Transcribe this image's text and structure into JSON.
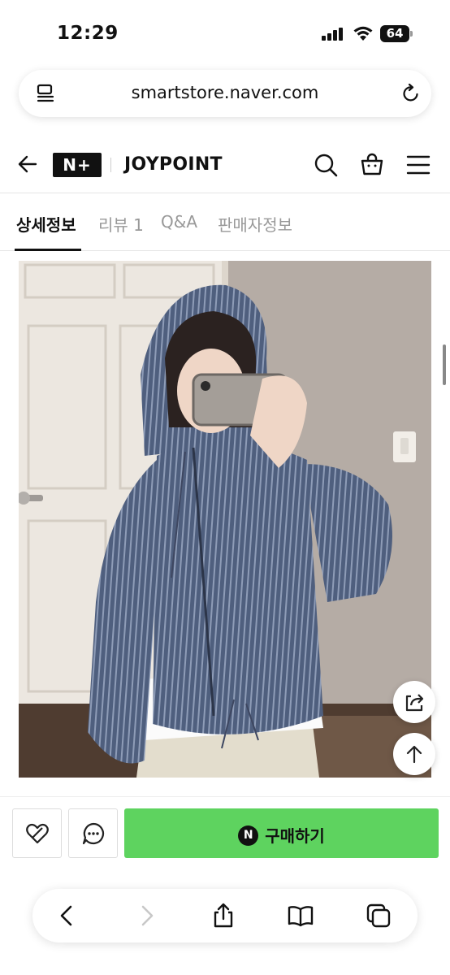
{
  "status_bar": {
    "time": "12:29",
    "battery": "64"
  },
  "browser": {
    "url": "smartstore.naver.com"
  },
  "header": {
    "brand_logo_text": "N+",
    "store_name": "JOYPOINT"
  },
  "tabs": [
    {
      "label": "상세정보",
      "active": true
    },
    {
      "label": "리뷰 1",
      "active": false
    },
    {
      "label": "Q&A",
      "active": false
    },
    {
      "label": "판매자정보",
      "active": false
    }
  ],
  "action_bar": {
    "npay_mark": "N",
    "buy_label": "구매하기"
  },
  "colors": {
    "buy_green": "#5ed35f",
    "text_dark": "#111111",
    "tab_inactive": "#999999"
  },
  "icons": {
    "header": [
      "back-arrow-icon",
      "search-icon",
      "cart-icon",
      "menu-icon"
    ],
    "floating": [
      "share-icon",
      "scroll-top-icon"
    ],
    "action": [
      "wish-icon",
      "chat-icon"
    ],
    "toolbar": [
      "back-icon",
      "forward-icon",
      "share-icon",
      "bookmarks-icon",
      "tabs-icon"
    ]
  }
}
